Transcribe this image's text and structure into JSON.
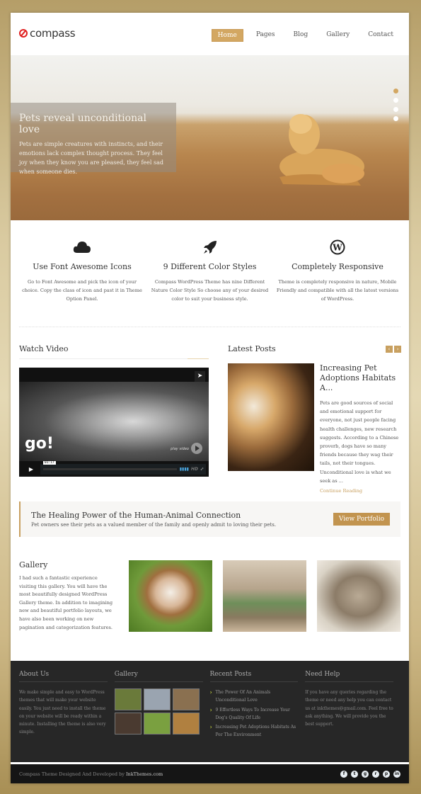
{
  "header": {
    "logo_text": "compass",
    "nav": [
      {
        "label": "Home",
        "active": true
      },
      {
        "label": "Pages"
      },
      {
        "label": "Blog"
      },
      {
        "label": "Gallery"
      },
      {
        "label": "Contact"
      }
    ]
  },
  "hero": {
    "title": "Pets reveal unconditional love",
    "text": "Pets are simple creatures with instincts, and their emotions lack complex thought process. They feel joy when they know you are pleased, they feel sad when someone dies.",
    "slide_count": 4,
    "active_slide": 1
  },
  "features": [
    {
      "icon": "cloud-icon",
      "title": "Use Font Awesome Icons",
      "text": "Go to Font Awesome and pick the icon of your choice. Copy the class of icon and past it in Theme Option Panel."
    },
    {
      "icon": "rocket-icon",
      "title": "9 Different Color Styles",
      "text": "Compass WordPress Theme has nine Different Nature Color Style So choose any of your desired color to suit your business style."
    },
    {
      "icon": "wordpress-icon",
      "title": "Completely Responsive",
      "text": "Theme is completely responsive in nature, Mobile Friendly and compatible with all the latest versions of WordPress."
    }
  ],
  "video": {
    "heading": "Watch Video",
    "brand": "go!",
    "play_label": "play video",
    "time": "01:17",
    "hd_label": "HD"
  },
  "latest_posts": {
    "heading": "Latest Posts",
    "prev": "‹",
    "next": "›",
    "post": {
      "title": "Increasing Pet Adoptions Habitats A...",
      "text": "Pets are good sources of social and emotional support for everyone, not just people facing health challenges, new research suggests. According to a Chinese proverb, dogs have so many friends because they wag their tails, not their tongues. Unconditional love is what we seek as ...",
      "more": "Continue Reading"
    }
  },
  "cta": {
    "title": "The Healing Power of the Human-Animal Connection",
    "subtitle": "Pet owners see their pets as a valued member of the family and openly admit to loving their pets.",
    "button": "View Portfolio"
  },
  "gallery": {
    "title": "Gallery",
    "text": "I had such a fantastic experience visiting this gallery. You will have the most beautifully designed WordPress Gallery theme. In addition to imagining new and beautiful portfolio layouts, we have also been working on new pagination and categorization features."
  },
  "footer": {
    "about": {
      "heading": "About Us",
      "text": "We make simple and easy to WordPress themes that will make your website easily. You just need to install the theme on your website will be ready within a minute. Installing the theme is also very simple."
    },
    "gallery_heading": "Gallery",
    "recent": {
      "heading": "Recent Posts",
      "items": [
        "The Power Of An Animals Unconditional Love",
        "9 Effortless Ways To Increase Your Dog's Quality Of Life",
        "Increasing Pet Adoptions Habitats As Per The Environment"
      ]
    },
    "help": {
      "heading": "Need Help",
      "text": "If you have any queries regarding the theme or need any help you can contact us at inkthemes@gmail.com. Feel free to ask anything. We will provide you the best support."
    },
    "credit_prefix": "Compass Theme Designed And Developed by ",
    "credit_link": "InkThemes.com",
    "social": [
      {
        "name": "facebook-icon",
        "glyph": "f"
      },
      {
        "name": "twitter-icon",
        "glyph": "t"
      },
      {
        "name": "google-plus-icon",
        "glyph": "g"
      },
      {
        "name": "rss-icon",
        "glyph": "r"
      },
      {
        "name": "pinterest-icon",
        "glyph": "p"
      },
      {
        "name": "linkedin-icon",
        "glyph": "in"
      }
    ]
  }
}
